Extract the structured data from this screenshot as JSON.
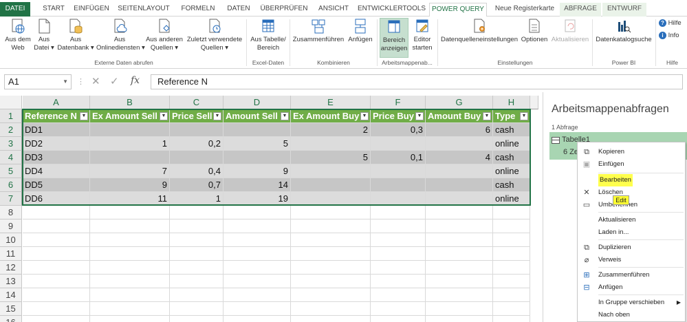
{
  "ribbon_tabs": [
    "DATEI",
    "START",
    "EINFÜGEN",
    "SEITENLAYOUT",
    "FORMELN",
    "DATEN",
    "ÜBERPRÜFEN",
    "ANSICHT",
    "ENTWICKLERTOOLS",
    "POWER QUERY",
    "Neue Registerkarte",
    "ABFRAGE",
    "ENTWURF"
  ],
  "ribbon": {
    "web": [
      "Aus dem",
      "Web"
    ],
    "datei": [
      "Aus",
      "Datei ▾"
    ],
    "datenbank": [
      "Aus",
      "Datenbank ▾"
    ],
    "online": [
      "Aus",
      "Onlinediensten ▾"
    ],
    "andere": [
      "Aus anderen",
      "Quellen ▾"
    ],
    "zuletzt": [
      "Zuletzt verwendete",
      "Quellen ▾"
    ],
    "tabelle": [
      "Aus Tabelle/",
      "Bereich"
    ],
    "zusammen": "Zusammenführen",
    "anfuegen": "Anfügen",
    "bereich": [
      "Bereich",
      "anzeigen"
    ],
    "editor": [
      "Editor",
      "starten"
    ],
    "datenquellen": "Datenquelleneinstellungen",
    "optionen": "Optionen",
    "aktualisieren": "Aktualisieren",
    "katalog": "Datenkatalogsuche",
    "hilfe": "Hilfe",
    "info": "Info",
    "groups": {
      "extern": "Externe Daten abrufen",
      "excel": "Excel-Daten",
      "kombinieren": "Kombinieren",
      "arbeitsmappe": "Arbeitsmappenab...",
      "einstellungen": "Einstellungen",
      "powerbi": "Power BI",
      "hilfe": "Hilfe"
    }
  },
  "formula_bar": {
    "name_box": "A1",
    "fx": "fx",
    "value": "Reference N"
  },
  "sheet": {
    "columns": [
      "A",
      "B",
      "C",
      "D",
      "E",
      "F",
      "G",
      "H"
    ],
    "rows": [
      "1",
      "2",
      "3",
      "4",
      "5",
      "6",
      "7",
      "8",
      "9",
      "10",
      "11",
      "12",
      "13",
      "14",
      "15",
      "16"
    ],
    "header": [
      "Reference N",
      "Ex Amount Sell",
      "Price Sell",
      "Amount Sell",
      "Ex Amount Buy",
      "Price Buy",
      "Amount Buy",
      "Type"
    ],
    "data": [
      [
        "DD1",
        "",
        "",
        "",
        "2",
        "0,3",
        "6",
        "cash"
      ],
      [
        "DD2",
        "1",
        "0,2",
        "5",
        "",
        "",
        "",
        "online"
      ],
      [
        "DD3",
        "",
        "",
        "",
        "5",
        "0,1",
        "4",
        "cash"
      ],
      [
        "DD4",
        "7",
        "0,4",
        "9",
        "",
        "",
        "",
        "online"
      ],
      [
        "DD5",
        "9",
        "0,7",
        "14",
        "",
        "",
        "",
        "cash"
      ],
      [
        "DD6",
        "11",
        "1",
        "19",
        "",
        "",
        "",
        "online"
      ]
    ]
  },
  "pane": {
    "title": "Arbeitsmappenabfragen",
    "count": "1 Abfrage",
    "query_name": "Tabelle1",
    "query_sub": "6 Ze"
  },
  "context_menu": {
    "items": [
      "Kopieren",
      "Einfügen",
      "Bearbeiten",
      "Löschen",
      "Umbenennen",
      "Aktualisieren",
      "Laden in...",
      "Duplizieren",
      "Verweis",
      "Zusammenführen",
      "Anfügen",
      "In Gruppe verschieben",
      "Nach oben"
    ],
    "tooltip": "Edit"
  },
  "colors": {
    "excel_green": "#217346",
    "table_header": "#70ad47",
    "band_dark": "#c6c6c6",
    "band_light": "#dcdcdc",
    "highlight": "#ffff4d"
  }
}
